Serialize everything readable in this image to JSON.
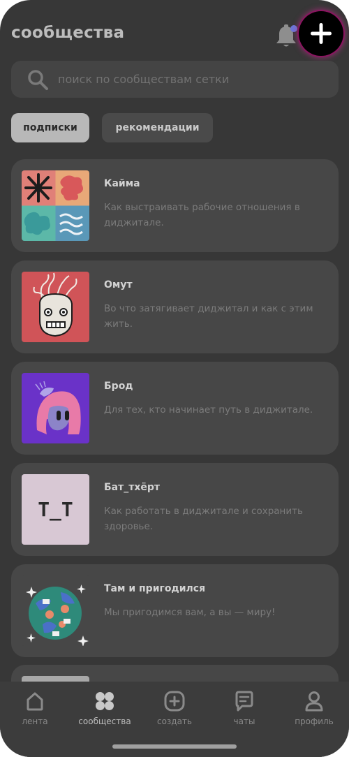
{
  "header": {
    "title": "сообщества"
  },
  "search": {
    "placeholder": "поиск по сообществам сетки"
  },
  "chips": [
    {
      "label": "подписки",
      "selected": true
    },
    {
      "label": "рекомендации",
      "selected": false
    }
  ],
  "communities": [
    {
      "name": "Кайма",
      "description": "Как выстраивать рабочие отношения в диджитале."
    },
    {
      "name": "Омут",
      "description": "Во что затягивает диджитал и как с этим жить."
    },
    {
      "name": "Брод",
      "description": "Для тех, кто начинает путь в диджитале."
    },
    {
      "name": "Бат_тхёрт",
      "description": "Как работать в диджитале и сохранить здоровье.",
      "thumb_text": "T_T"
    },
    {
      "name": "Там и пригодился",
      "description": "Мы пригодимся вам, а вы — миру!"
    }
  ],
  "nav": {
    "items": [
      {
        "label": "лента",
        "icon": "home-icon"
      },
      {
        "label": "сообщества",
        "icon": "grid-icon",
        "active": true
      },
      {
        "label": "создать",
        "icon": "add-square-icon"
      },
      {
        "label": "чаты",
        "icon": "chat-icon"
      },
      {
        "label": "профиль",
        "icon": "profile-icon"
      }
    ]
  },
  "colors": {
    "background": "#373737",
    "card": "#474747",
    "accent_glow": "#c8288c",
    "notification_dot": "#6b76d8"
  }
}
